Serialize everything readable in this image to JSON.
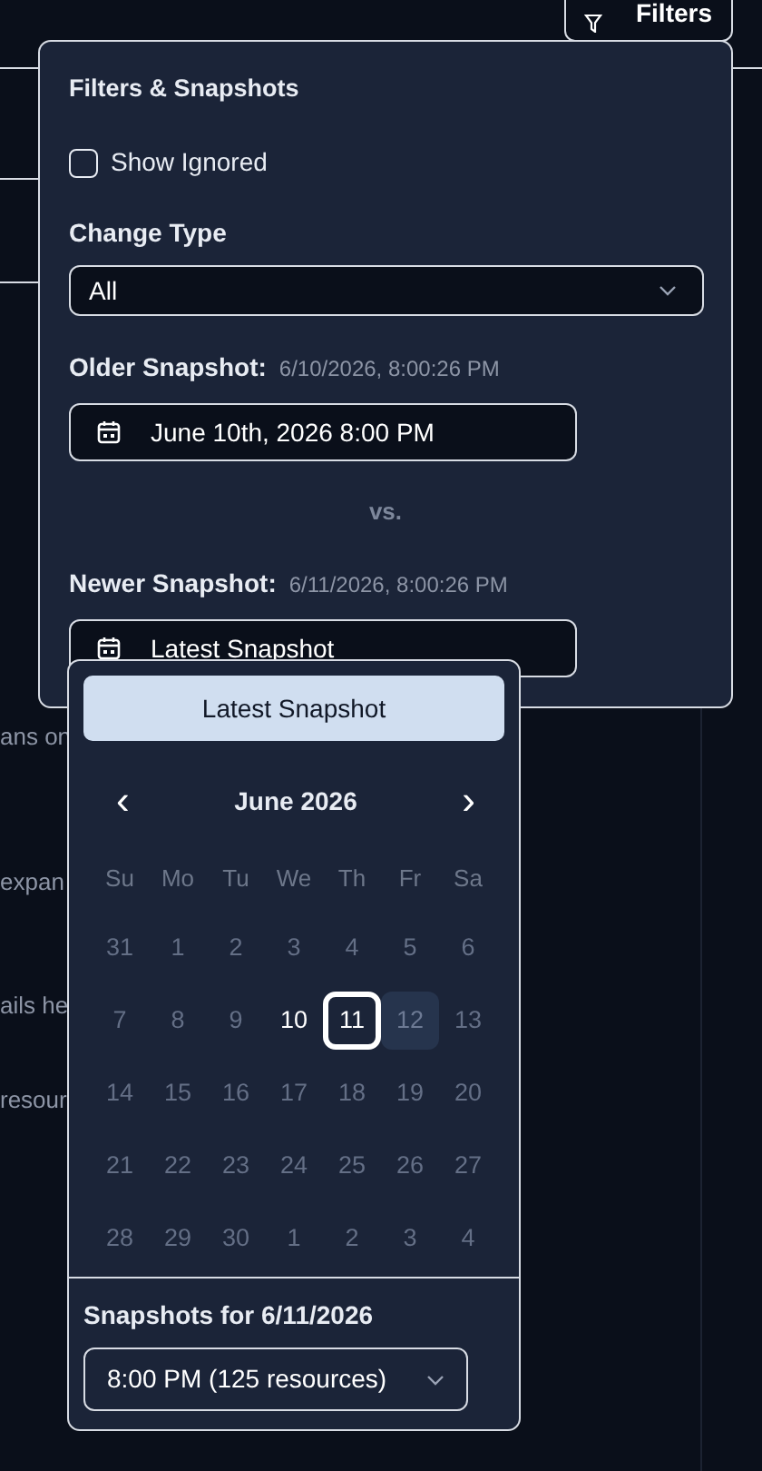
{
  "toolbar": {
    "filters_button": "Filters"
  },
  "background_texts": [
    "ans on",
    "expan",
    "ails he",
    "resour"
  ],
  "filters_panel": {
    "title": "Filters & Snapshots",
    "show_ignored": {
      "label": "Show Ignored",
      "checked": false
    },
    "change_type": {
      "label": "Change Type",
      "value": "All"
    },
    "older_snapshot": {
      "label": "Older Snapshot:",
      "timestamp": "6/10/2026, 8:00:26 PM",
      "value": "June 10th, 2026 8:00 PM"
    },
    "separator": "vs.",
    "newer_snapshot": {
      "label": "Newer Snapshot:",
      "timestamp": "6/11/2026, 8:00:26 PM",
      "value": "Latest Snapshot"
    }
  },
  "date_picker": {
    "latest_button": "Latest Snapshot",
    "prev": "‹",
    "next": "›",
    "month": "June 2026",
    "weekdays": [
      "Su",
      "Mo",
      "Tu",
      "We",
      "Th",
      "Fr",
      "Sa"
    ],
    "weeks": [
      [
        {
          "label": "31",
          "enabled": false,
          "selected": false,
          "today": false
        },
        {
          "label": "1",
          "enabled": false,
          "selected": false,
          "today": false
        },
        {
          "label": "2",
          "enabled": false,
          "selected": false,
          "today": false
        },
        {
          "label": "3",
          "enabled": false,
          "selected": false,
          "today": false
        },
        {
          "label": "4",
          "enabled": false,
          "selected": false,
          "today": false
        },
        {
          "label": "5",
          "enabled": false,
          "selected": false,
          "today": false
        },
        {
          "label": "6",
          "enabled": false,
          "selected": false,
          "today": false
        }
      ],
      [
        {
          "label": "7",
          "enabled": false,
          "selected": false,
          "today": false
        },
        {
          "label": "8",
          "enabled": false,
          "selected": false,
          "today": false
        },
        {
          "label": "9",
          "enabled": false,
          "selected": false,
          "today": false
        },
        {
          "label": "10",
          "enabled": true,
          "selected": false,
          "today": false
        },
        {
          "label": "11",
          "enabled": true,
          "selected": true,
          "today": false
        },
        {
          "label": "12",
          "enabled": false,
          "selected": false,
          "today": true
        },
        {
          "label": "13",
          "enabled": false,
          "selected": false,
          "today": false
        }
      ],
      [
        {
          "label": "14",
          "enabled": false,
          "selected": false,
          "today": false
        },
        {
          "label": "15",
          "enabled": false,
          "selected": false,
          "today": false
        },
        {
          "label": "16",
          "enabled": false,
          "selected": false,
          "today": false
        },
        {
          "label": "17",
          "enabled": false,
          "selected": false,
          "today": false
        },
        {
          "label": "18",
          "enabled": false,
          "selected": false,
          "today": false
        },
        {
          "label": "19",
          "enabled": false,
          "selected": false,
          "today": false
        },
        {
          "label": "20",
          "enabled": false,
          "selected": false,
          "today": false
        }
      ],
      [
        {
          "label": "21",
          "enabled": false,
          "selected": false,
          "today": false
        },
        {
          "label": "22",
          "enabled": false,
          "selected": false,
          "today": false
        },
        {
          "label": "23",
          "enabled": false,
          "selected": false,
          "today": false
        },
        {
          "label": "24",
          "enabled": false,
          "selected": false,
          "today": false
        },
        {
          "label": "25",
          "enabled": false,
          "selected": false,
          "today": false
        },
        {
          "label": "26",
          "enabled": false,
          "selected": false,
          "today": false
        },
        {
          "label": "27",
          "enabled": false,
          "selected": false,
          "today": false
        }
      ],
      [
        {
          "label": "28",
          "enabled": false,
          "selected": false,
          "today": false
        },
        {
          "label": "29",
          "enabled": false,
          "selected": false,
          "today": false
        },
        {
          "label": "30",
          "enabled": false,
          "selected": false,
          "today": false
        },
        {
          "label": "1",
          "enabled": false,
          "selected": false,
          "today": false
        },
        {
          "label": "2",
          "enabled": false,
          "selected": false,
          "today": false
        },
        {
          "label": "3",
          "enabled": false,
          "selected": false,
          "today": false
        },
        {
          "label": "4",
          "enabled": false,
          "selected": false,
          "today": false
        }
      ]
    ],
    "snapshots_label": "Snapshots for 6/11/2026",
    "snapshot_value": "8:00 PM (125 resources)"
  }
}
